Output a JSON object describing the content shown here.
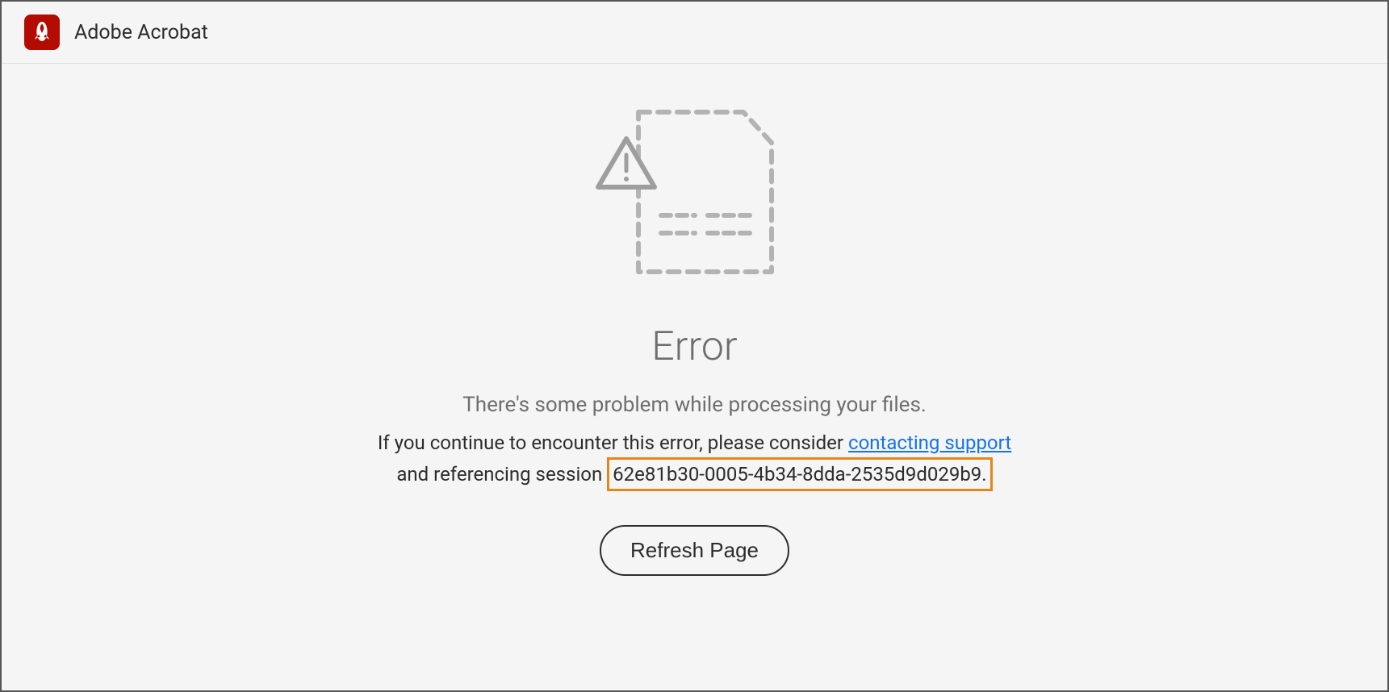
{
  "header": {
    "app_title": "Adobe Acrobat"
  },
  "error": {
    "heading": "Error",
    "subtext": "There's some problem while processing your files.",
    "detail_prefix": "If you continue to encounter this error, please consider ",
    "support_link_label": "contacting support",
    "detail_mid": " and referencing session ",
    "session_id": "62e81b30-0005-4b34-8dda-2535d9d029b9.",
    "refresh_label": "Refresh Page"
  }
}
